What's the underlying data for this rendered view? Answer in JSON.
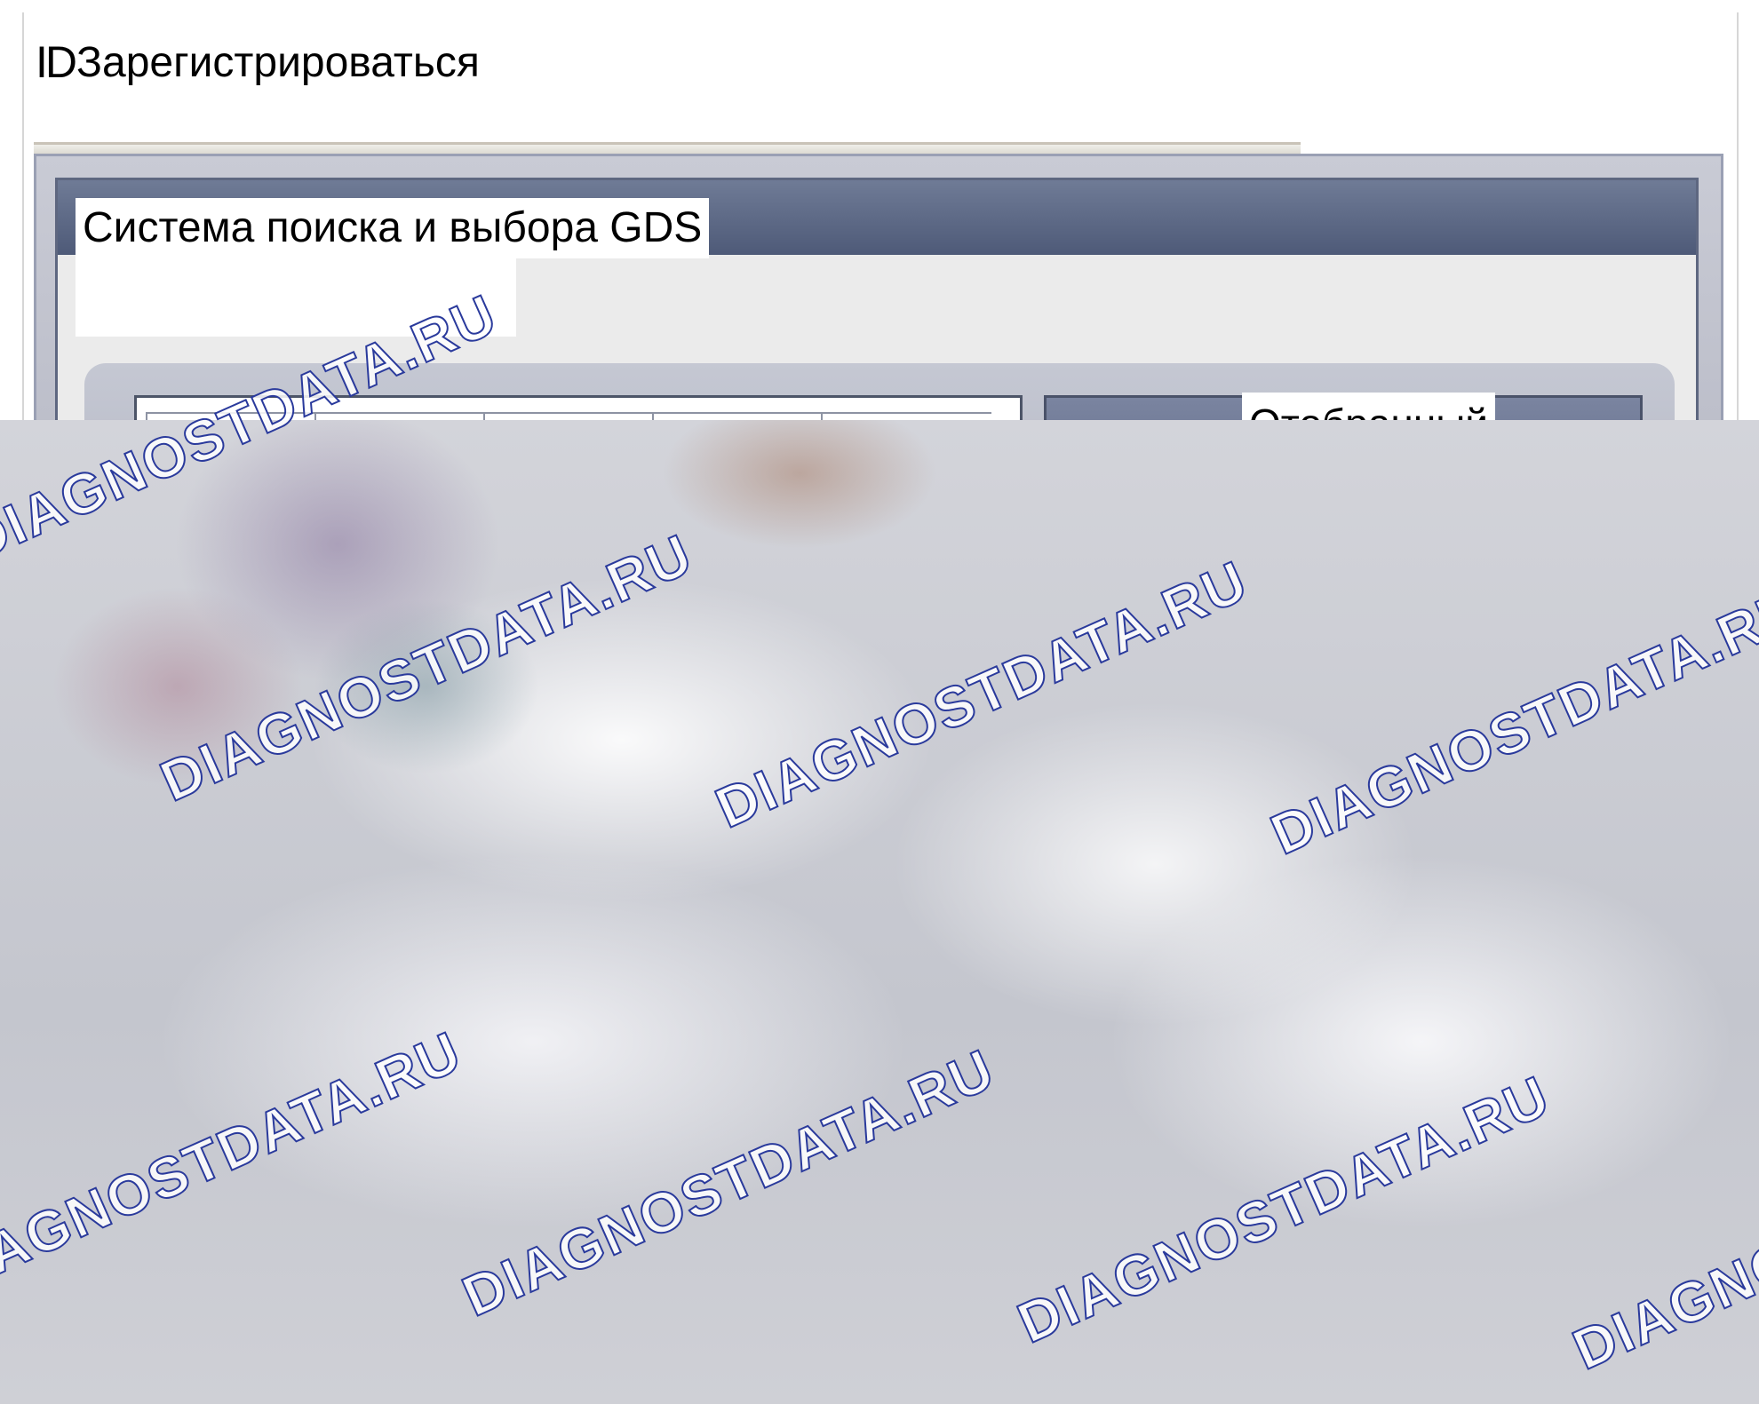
{
  "top_bar": {
    "id_label": "ID",
    "register_link": "Зарегистрироваться"
  },
  "window": {
    "title": "Система поиска и выбора GDS",
    "side_button_label": "Отобранный"
  },
  "watermark": {
    "text": "DIAGNOSTDATA.RU"
  },
  "colors": {
    "titlebar": "#55607d",
    "frame": "#b8bac6",
    "watermark_outline": "#2a3a9c"
  }
}
